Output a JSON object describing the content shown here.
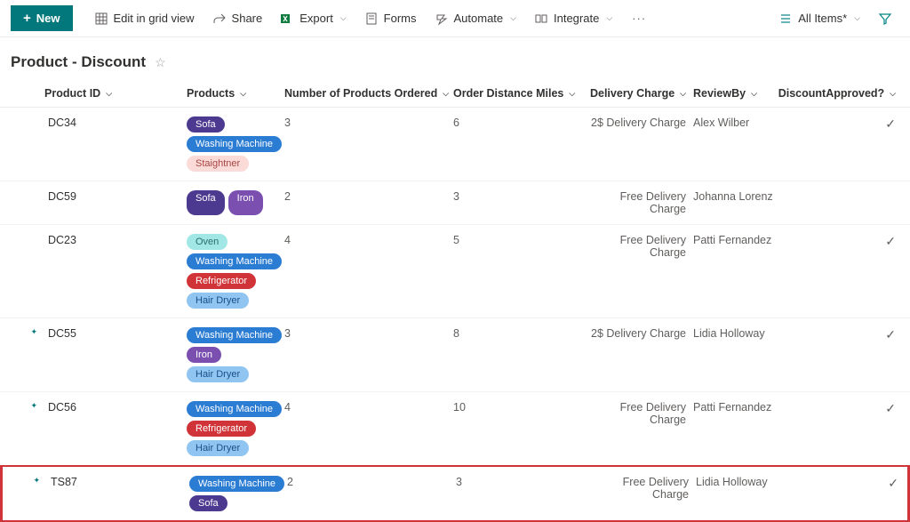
{
  "toolbar": {
    "new_label": "New",
    "edit_grid_label": "Edit in grid view",
    "share_label": "Share",
    "export_label": "Export",
    "forms_label": "Forms",
    "automate_label": "Automate",
    "integrate_label": "Integrate",
    "all_items_label": "All Items*"
  },
  "page_title": "Product - Discount",
  "columns": {
    "product_id": "Product ID",
    "products": "Products",
    "num_ordered": "Number of Products Ordered",
    "distance": "Order Distance Miles",
    "delivery": "Delivery Charge",
    "review_by": "ReviewBy",
    "discount_approved": "DiscountApproved?"
  },
  "pill_colors": {
    "Sofa": "p-sofa",
    "Washing Machine": "p-wash",
    "Staightner": "p-strait",
    "Iron": "p-iron",
    "Oven": "p-oven",
    "Refrigerator": "p-refrig",
    "Hair Dryer": "p-hair"
  },
  "rows": [
    {
      "new": false,
      "pid": "DC34",
      "products": [
        "Sofa",
        "Washing Machine",
        "Staightner"
      ],
      "num": "3",
      "dist": "6",
      "delivery": "2$ Delivery Charge",
      "review": "Alex Wilber",
      "approved": true
    },
    {
      "new": false,
      "pid": "DC59",
      "products": [
        "Sofa",
        "Iron"
      ],
      "num": "2",
      "dist": "3",
      "delivery": "Free Delivery Charge",
      "review": "Johanna Lorenz",
      "approved": false
    },
    {
      "new": false,
      "pid": "DC23",
      "products": [
        "Oven",
        "Washing Machine",
        "Refrigerator",
        "Hair Dryer"
      ],
      "num": "4",
      "dist": "5",
      "delivery": "Free Delivery Charge",
      "review": "Patti Fernandez",
      "approved": true
    },
    {
      "new": true,
      "pid": "DC55",
      "products": [
        "Washing Machine",
        "Iron",
        "Hair Dryer"
      ],
      "num": "3",
      "dist": "8",
      "delivery": "2$ Delivery Charge",
      "review": "Lidia Holloway",
      "approved": true
    },
    {
      "new": true,
      "pid": "DC56",
      "products": [
        "Washing Machine",
        "Refrigerator",
        "Hair Dryer"
      ],
      "num": "4",
      "dist": "10",
      "delivery": "Free Delivery Charge",
      "review": "Patti Fernandez",
      "approved": true
    },
    {
      "new": true,
      "pid": "TS87",
      "products": [
        "Washing Machine",
        "Sofa"
      ],
      "num": "2",
      "dist": "3",
      "delivery": "Free Delivery Charge",
      "review": "Lidia Holloway",
      "approved": true,
      "highlight": true
    }
  ]
}
